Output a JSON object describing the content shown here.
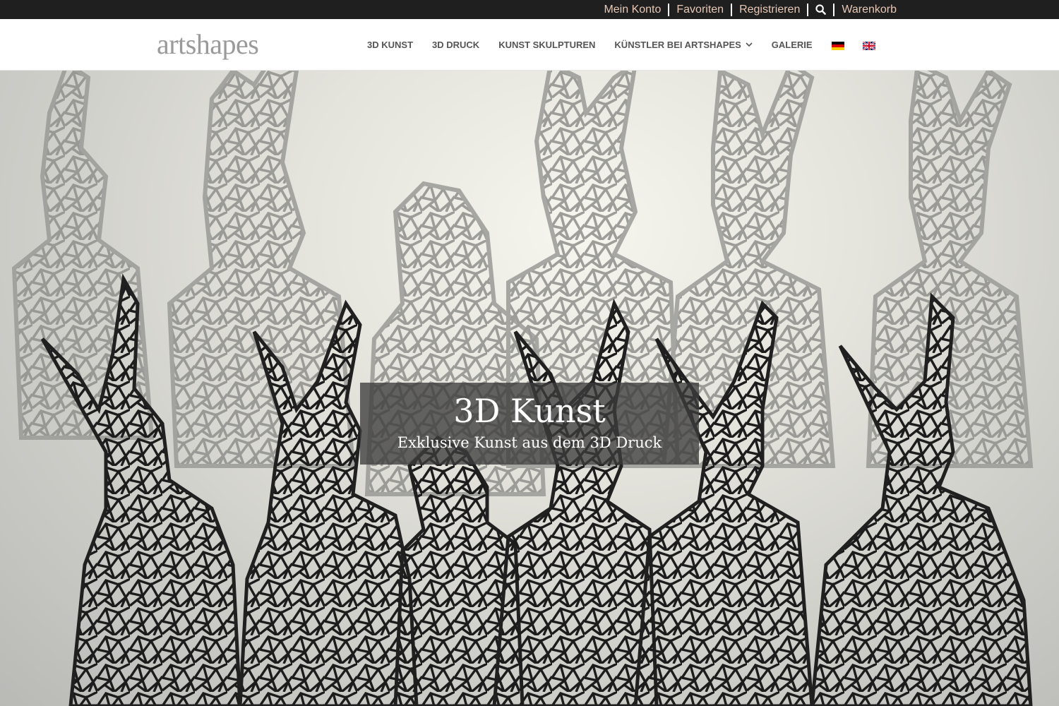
{
  "topbar": {
    "links": [
      "Mein Konto",
      "Favoriten",
      "Registrieren",
      "Warenkorb"
    ],
    "search_icon": "search-icon",
    "link_color": "#e7c8b6",
    "background": "#1f1f1f"
  },
  "header": {
    "logo": "artshapes",
    "nav": [
      "3D KUNST",
      "3D DRUCK",
      "KUNST SKULPTUREN",
      "KÜNSTLER BEI ARTSHAPES",
      "GALERIE"
    ],
    "languages": [
      "de-flag-icon",
      "uk-flag-icon"
    ]
  },
  "hero": {
    "title": "3D Kunst",
    "subtitle": "Exklusive Kunst aus dem 3D Druck",
    "image": "wireframe-rabbit-sculptures"
  }
}
